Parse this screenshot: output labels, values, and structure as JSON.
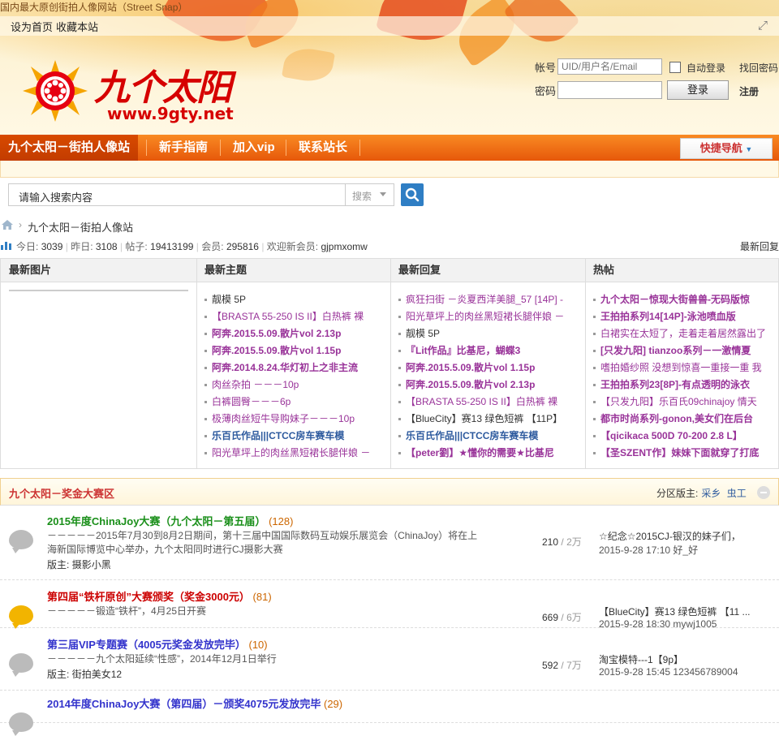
{
  "header": {
    "slogan": "国内最大原创街拍人像网站（Street Snap）",
    "set_home": "设为首页",
    "bookmark": "收藏本站",
    "logo_text": "九个太阳",
    "logo_url": "www.9gty.net"
  },
  "login": {
    "account_label": "帐号",
    "account_placeholder": "UID/用户名/Email",
    "password_label": "密码",
    "auto_login": "自动登录",
    "forgot": "找回密码",
    "login_button": "登录",
    "register": "注册"
  },
  "nav": {
    "items": [
      "九个太阳－街拍人像站",
      "新手指南",
      "加入vip",
      "联系站长"
    ],
    "quick_nav": "快捷导航"
  },
  "search": {
    "placeholder": "请输入搜索内容",
    "type": "搜索"
  },
  "breadcrumb": {
    "current": "九个太阳－街拍人像站"
  },
  "stats": {
    "today_label": "今日:",
    "today": "3039",
    "yesterday_label": "昨日:",
    "yesterday": "3108",
    "posts_label": "帖子:",
    "posts": "19413199",
    "members_label": "会员:",
    "members": "295816",
    "newest_label": "欢迎新会员:",
    "newest": "gjpmxomw",
    "latest_reply": "最新回复"
  },
  "panel": {
    "headers": [
      "最新图片",
      "最新主题",
      "最新回复",
      "热帖"
    ],
    "latest_topics": [
      {
        "text": "靓模 5P",
        "color": "#333333",
        "bold": false
      },
      {
        "text": "【BRASTA 55-250 IS II】白热裤 裸",
        "color": "#993399",
        "bold": false
      },
      {
        "text": "阿奔.2015.5.09.散片vol 2.13p",
        "color": "#993399",
        "bold": true
      },
      {
        "text": "阿奔.2015.5.09.散片vol 1.15p",
        "color": "#993399",
        "bold": true
      },
      {
        "text": "阿奔.2014.8.24.华灯初上之非主流",
        "color": "#993399",
        "bold": true
      },
      {
        "text": "肉丝杂拍 －－－10p",
        "color": "#993399",
        "bold": false
      },
      {
        "text": "白裤圆臀－－－6p",
        "color": "#993399",
        "bold": false
      },
      {
        "text": "极薄肉丝短牛导购妹子－－－10p",
        "color": "#993399",
        "bold": false
      },
      {
        "text": "乐百氏作品|||CTCC房车赛车模",
        "color": "#2d5a9e",
        "bold": true
      },
      {
        "text": "阳光草坪上的肉丝黑短裙长腿伴娘 －",
        "color": "#993399",
        "bold": false
      }
    ],
    "latest_replies": [
      {
        "text": "疯狂扫街 －炎夏西洋美腿_57 [14P] -",
        "color": "#993399",
        "bold": false
      },
      {
        "text": "阳光草坪上的肉丝黑短裙长腿伴娘 －",
        "color": "#993399",
        "bold": false
      },
      {
        "text": "靓模 5P",
        "color": "#333333",
        "bold": false
      },
      {
        "text": "『Lit作品』比基尼，蝴蝶3",
        "color": "#993399",
        "bold": true
      },
      {
        "text": "阿奔.2015.5.09.散片vol 1.15p",
        "color": "#993399",
        "bold": true
      },
      {
        "text": "阿奔.2015.5.09.散片vol 2.13p",
        "color": "#993399",
        "bold": true
      },
      {
        "text": "【BRASTA 55-250 IS II】白热裤 裸",
        "color": "#993399",
        "bold": false
      },
      {
        "text": "【BlueCity】赛13 绿色短裤 【11P】",
        "color": "#333333",
        "bold": false
      },
      {
        "text": "乐百氏作品|||CTCC房车赛车模",
        "color": "#2d5a9e",
        "bold": true
      },
      {
        "text": "【peter劉】★懂你的需要★比基尼",
        "color": "#993399",
        "bold": true
      }
    ],
    "hot_posts": [
      {
        "text": "九个太阳－惊现大街兽兽-无码版惊",
        "color": "#993399",
        "bold": true
      },
      {
        "text": "王拍拍系列14[14P]-泳池喷血版",
        "color": "#993399",
        "bold": true
      },
      {
        "text": "白裙实在太短了，走着走着居然露出了",
        "color": "#993399",
        "bold": false
      },
      {
        "text": "[只发九阳] tianzoo系列－一激情夏",
        "color": "#993399",
        "bold": true
      },
      {
        "text": "嗜拍婚纱照 没想到惊喜一重接一重 我",
        "color": "#993399",
        "bold": false
      },
      {
        "text": "王拍拍系列23[8P]-有点透明的泳衣",
        "color": "#993399",
        "bold": true
      },
      {
        "text": "【只发九阳】乐百氏09chinajoy 情天",
        "color": "#993399",
        "bold": false
      },
      {
        "text": "都市时尚系列-gonon,美女们在后台",
        "color": "#993399",
        "bold": true
      },
      {
        "text": "【qicikaca 500D 70-200 2.8 L】",
        "color": "#993399",
        "bold": true
      },
      {
        "text": "【圣SZENT作】妹妹下面就穿了打底",
        "color": "#993399",
        "bold": true
      }
    ]
  },
  "section": {
    "title": "九个太阳－奖金大赛区",
    "mods_label": "分区版主:",
    "mods": [
      "采乡",
      "虫工"
    ]
  },
  "forums": [
    {
      "title": "2015年度ChinaJoy大赛（九个太阳－第五届）",
      "title_color": "#1a8f1a",
      "count": "(128)",
      "bubble": "#bbbbbb",
      "desc": "－－－－－2015年7月30到8月2日期间，第十三届中国国际数码互动娱乐展览会（ChinaJoy）将在上海新国际博览中心举办，九个太阳同时进行CJ摄影大赛",
      "mod_label": "版主:",
      "mod": "摄影小黑",
      "topics": "210",
      "posts": "2万",
      "last_title": "☆纪念☆2015CJ-银汉的妹子们，",
      "last_time": "2015-9-28 17:10",
      "last_user": "好_好"
    },
    {
      "title": "第四届“铁杆原创”大赛颁奖（奖金3000元）",
      "title_color": "#cc0000",
      "count": "(81)",
      "bubble": "#f2b400",
      "desc": "－－－－－锻造“铁杆”，4月25日开赛",
      "mod_label": "",
      "mod": "",
      "topics": "669",
      "posts": "6万",
      "last_title": "【BlueCity】赛13 绿色短裤 【11 ...",
      "last_time": "2015-9-28 18:30",
      "last_user": "mywj1005"
    },
    {
      "title": "第三届VIP专题赛（4005元奖金发放完毕）",
      "title_color": "#3333cc",
      "count": "(10)",
      "bubble": "#bbbbbb",
      "desc": "－－－－－九个太阳延续“性感”，2014年12月1日举行",
      "mod_label": "版主:",
      "mod": "街拍美女12",
      "topics": "592",
      "posts": "7万",
      "last_title": "淘宝模特---1【9p】",
      "last_time": "2015-9-28 15:45",
      "last_user": "123456789004"
    },
    {
      "title": "2014年度ChinaJoy大赛（第四届）－颁奖4075元发放完毕",
      "title_color": "#3333cc",
      "count": "(29)",
      "bubble": "#bbbbbb",
      "desc": "",
      "mod_label": "",
      "mod": "",
      "topics": "",
      "posts": "",
      "last_title": "",
      "last_time": "",
      "last_user": ""
    }
  ]
}
